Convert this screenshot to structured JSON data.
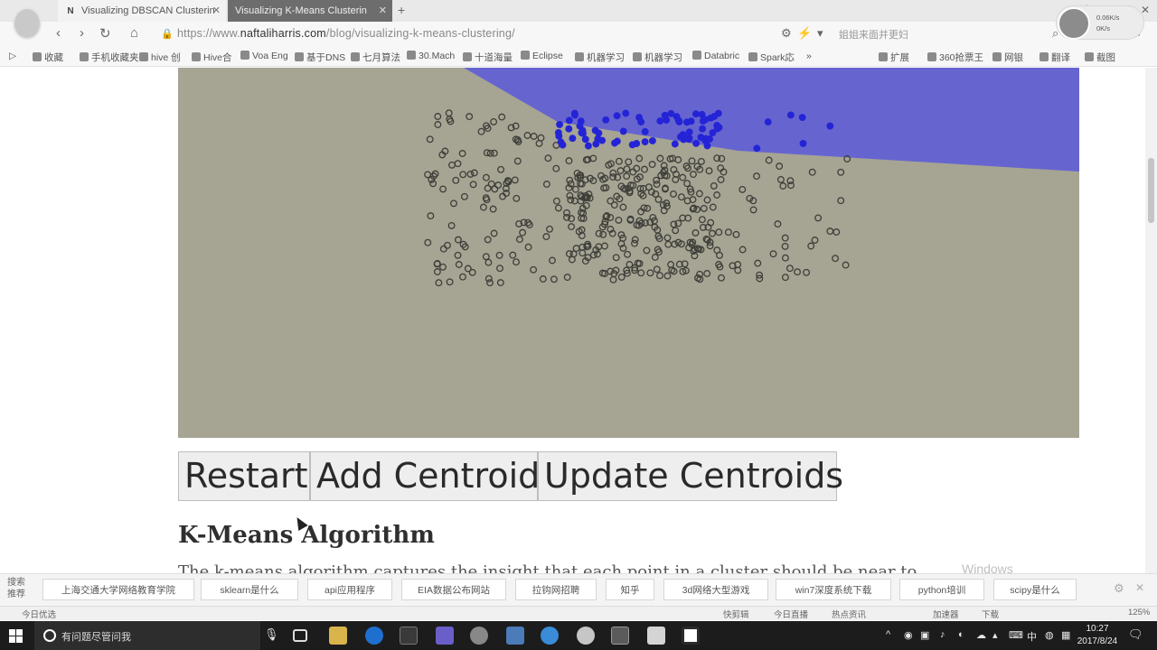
{
  "browser": {
    "tabs": [
      {
        "label": "Visualizing DBSCAN Clusterin",
        "favicon": "N"
      },
      {
        "label": "Visualizing K-Means Clusterin",
        "favicon": ""
      }
    ],
    "new_tab": "+",
    "url_prefix": "https://www.",
    "url_domain": "naftaliharris.com",
    "url_path": "/blog/visualizing-k-means-clustering/",
    "search_hint": "姐姐来面并更妇",
    "bookmarks": [
      "收藏",
      "手机收藏夹",
      "hive 创",
      "Hive合",
      "Voa Eng",
      "基于DNS",
      "七月算法",
      "30.Mach",
      "十道海量",
      "Eclipse",
      "机器学习",
      "机器学习",
      "Databric",
      "Spark応",
      "扩展",
      "360抢票王",
      "网银",
      "翻译",
      "截图"
    ]
  },
  "speed_widget": {
    "down": "0.06K/s",
    "up": "0K/s"
  },
  "visualization": {
    "background_color": "#a6a493",
    "region_color": "#5a5adb",
    "point_color": "#3f3f3a",
    "cluster_color": "#2424d6"
  },
  "buttons": {
    "restart": "Restart",
    "add_centroid": "Add Centroid",
    "update_centroids": "Update Centroids"
  },
  "section_heading": "K-Means Algorithm",
  "partial_paragraph": "The k-means algorithm captures the insight that each point in a cluster should be near to",
  "suggestions": {
    "label": "搜索推荐",
    "items": [
      "上海交通大学网络教育学院",
      "sklearn是什么",
      "api应用程序",
      "EIA数据公布网站",
      "拉钩网招聘",
      "知乎",
      "3d网络大型游戏",
      "win7深度系统下载",
      "python培训",
      "scipy是什么"
    ]
  },
  "watermark": "Windows",
  "statusbar": {
    "left": "今日优选",
    "items": [
      "快剪辑",
      "今日直播",
      "热点资讯",
      "加速器",
      "下载",
      "125%"
    ]
  },
  "taskbar": {
    "search_placeholder": "有问题尽管问我",
    "ime": "中",
    "time": "10:27",
    "date": "2017/8/24"
  }
}
